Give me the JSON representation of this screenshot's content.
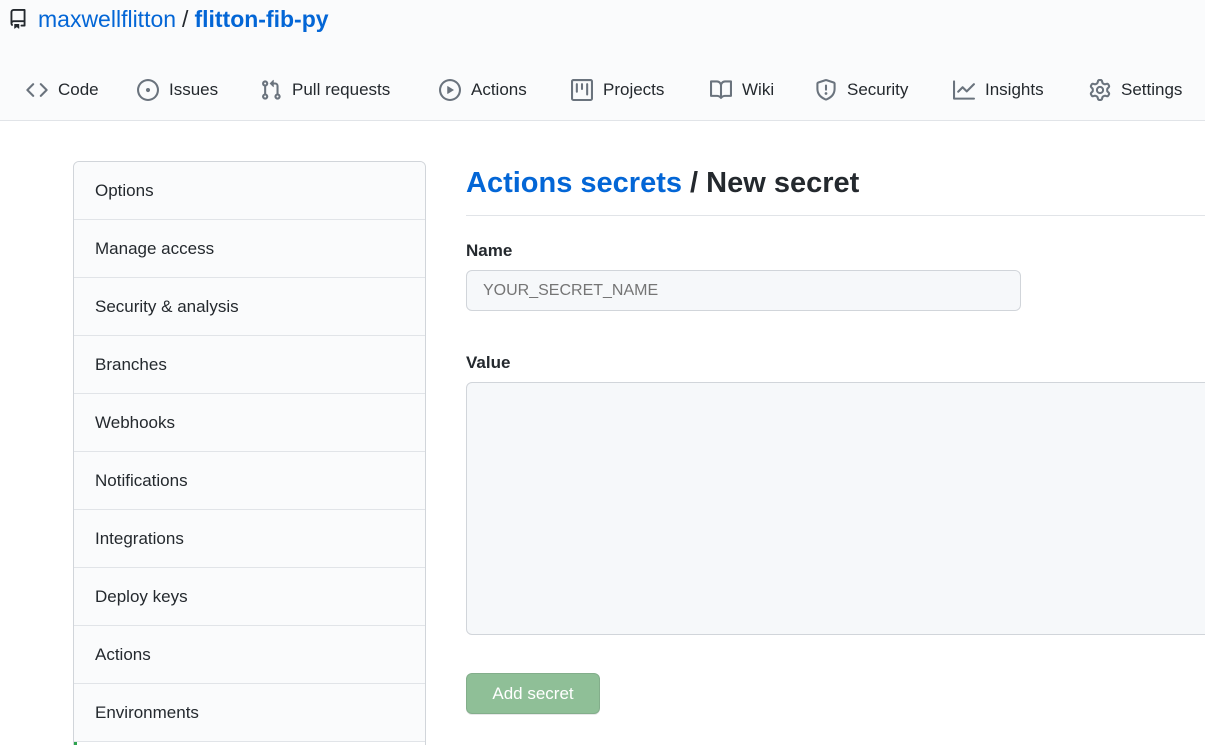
{
  "repo": {
    "owner": "maxwellflitton",
    "separator": "/",
    "name": "flitton-fib-py"
  },
  "tabs": [
    {
      "label": "Code",
      "icon": "code-icon"
    },
    {
      "label": "Issues",
      "icon": "issue-icon"
    },
    {
      "label": "Pull requests",
      "icon": "pull-request-icon"
    },
    {
      "label": "Actions",
      "icon": "play-icon"
    },
    {
      "label": "Projects",
      "icon": "project-icon"
    },
    {
      "label": "Wiki",
      "icon": "book-icon"
    },
    {
      "label": "Security",
      "icon": "shield-icon"
    },
    {
      "label": "Insights",
      "icon": "graph-icon"
    },
    {
      "label": "Settings",
      "icon": "gear-icon"
    }
  ],
  "sidebar": {
    "items": [
      {
        "label": "Options"
      },
      {
        "label": "Manage access"
      },
      {
        "label": "Security & analysis"
      },
      {
        "label": "Branches"
      },
      {
        "label": "Webhooks"
      },
      {
        "label": "Notifications"
      },
      {
        "label": "Integrations"
      },
      {
        "label": "Deploy keys"
      },
      {
        "label": "Actions"
      },
      {
        "label": "Environments"
      }
    ]
  },
  "page": {
    "breadcrumb": "Actions secrets",
    "separator": " / ",
    "title": "New secret"
  },
  "form": {
    "name_label": "Name",
    "name_placeholder": "YOUR_SECRET_NAME",
    "value_label": "Value",
    "submit_label": "Add secret"
  },
  "colors": {
    "link": "#0366d6",
    "text": "#24292e",
    "header_bg": "#fafbfc",
    "button_disabled_green": "#8fbf97",
    "active_indicator": "#2ea44f"
  }
}
